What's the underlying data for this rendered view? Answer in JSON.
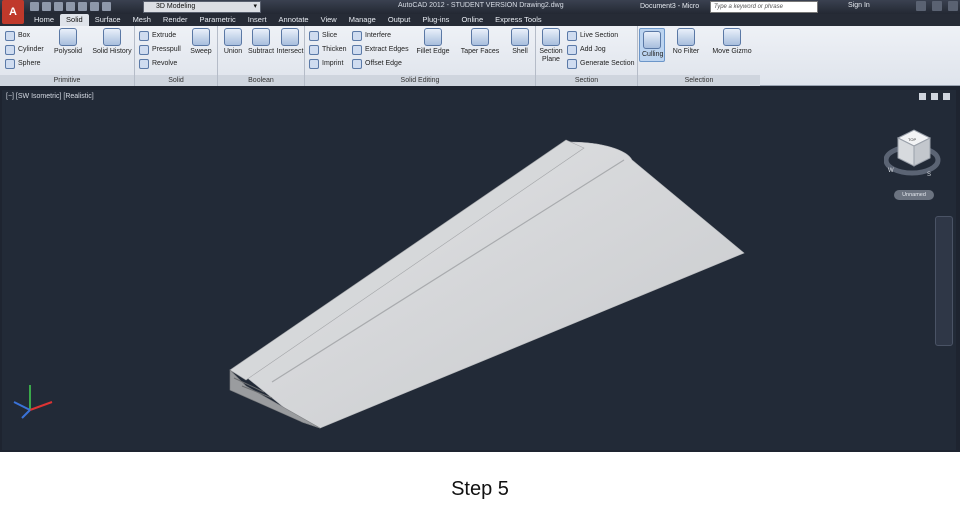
{
  "app": {
    "logo": "A",
    "workspace": "3D Modeling",
    "window_title": "AutoCAD 2012 - STUDENT VERSION    Drawing2.dwg",
    "document_tab": "Document3 - Micro",
    "search_placeholder": "Type a keyword or phrase",
    "sign_in": "Sign In"
  },
  "menu": [
    "Home",
    "Solid",
    "Surface",
    "Mesh",
    "Render",
    "Parametric",
    "Insert",
    "Annotate",
    "View",
    "Manage",
    "Output",
    "Plug-ins",
    "Online",
    "Express Tools"
  ],
  "active_menu": "Solid",
  "ribbon": {
    "primitive": {
      "title": "Primitive",
      "small": [
        "Box",
        "Cylinder",
        "Sphere"
      ],
      "large": [
        "Polysolid",
        "Solid History"
      ]
    },
    "solid": {
      "title": "Solid",
      "small": [
        "Extrude",
        "Presspull",
        "Revolve"
      ],
      "large": [
        "Sweep"
      ]
    },
    "boolean": {
      "title": "Boolean",
      "large": [
        "Union",
        "Subtract",
        "Intersect"
      ]
    },
    "solid_editing": {
      "title": "Solid Editing",
      "small1": [
        "Slice",
        "Thicken",
        "Imprint"
      ],
      "small2": [
        "Interfere",
        "Extract Edges",
        "Offset Edge"
      ],
      "large": [
        "Fillet Edge",
        "Taper Faces",
        "Shell"
      ]
    },
    "section": {
      "title": "Section",
      "large": [
        "Section Plane"
      ],
      "small": [
        "Live Section",
        "Add Jog",
        "Generate Section"
      ]
    },
    "selection": {
      "title": "Selection",
      "large": [
        "Culling",
        "No Filter",
        "Move Gizmo"
      ]
    }
  },
  "viewport": {
    "label": "[−] [SW Isometric] [Realistic]",
    "viewcube_face": "TOP",
    "compass_w": "W",
    "compass_s": "S",
    "ucs_name": "Unnamed"
  },
  "caption": "Step 5",
  "colors": {
    "viewport_bg": "#222a37",
    "model": "#cfd1d3",
    "accent": "#c0392b"
  }
}
